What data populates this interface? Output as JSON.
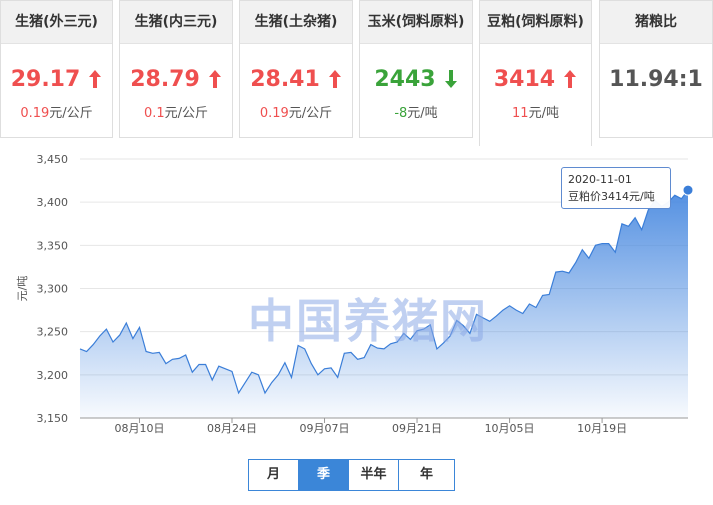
{
  "cards": [
    {
      "title": "生猪(外三元)",
      "price": "29.17",
      "direction": "up",
      "change": "0.19",
      "unit": "元/公斤"
    },
    {
      "title": "生猪(内三元)",
      "price": "28.79",
      "direction": "up",
      "change": "0.1",
      "unit": "元/公斤"
    },
    {
      "title": "生猪(土杂猪)",
      "price": "28.41",
      "direction": "up",
      "change": "0.19",
      "unit": "元/公斤"
    },
    {
      "title": "玉米(饲料原料)",
      "price": "2443",
      "direction": "down",
      "change": "-8",
      "unit": "元/吨"
    },
    {
      "title": "豆粕(饲料原料)",
      "price": "3414",
      "direction": "up",
      "change": "11",
      "unit": "元/吨"
    },
    {
      "title": "猪粮比",
      "price": "11.94:1",
      "direction": "none",
      "change": "",
      "unit": ""
    }
  ],
  "colors": {
    "up": "#ef4f4f",
    "down": "#3aa33a",
    "line": "#3b7ed8",
    "area_top": "#4a8ae0",
    "accent": "#3b86d8"
  },
  "watermark": "中国养猪网",
  "tooltip": {
    "date": "2020-11-01",
    "label": "豆粕价3414元/吨"
  },
  "period_tabs": [
    {
      "label": "月",
      "active": false
    },
    {
      "label": "季",
      "active": true
    },
    {
      "label": "半年",
      "active": false
    },
    {
      "label": "年",
      "active": false
    }
  ],
  "chart_data": {
    "type": "area",
    "title": "",
    "xlabel": "",
    "ylabel": "元/吨",
    "ylim": [
      3150,
      3450
    ],
    "yticks": [
      3150,
      3200,
      3250,
      3300,
      3350,
      3400,
      3450
    ],
    "xticks": [
      "08月10日",
      "08月24日",
      "09月07日",
      "09月21日",
      "10月05日",
      "10月19日"
    ],
    "grid": true,
    "x": [
      "2020-08-01",
      "2020-08-02",
      "2020-08-03",
      "2020-08-04",
      "2020-08-05",
      "2020-08-06",
      "2020-08-07",
      "2020-08-08",
      "2020-08-09",
      "2020-08-10",
      "2020-08-11",
      "2020-08-12",
      "2020-08-13",
      "2020-08-14",
      "2020-08-15",
      "2020-08-16",
      "2020-08-17",
      "2020-08-18",
      "2020-08-19",
      "2020-08-20",
      "2020-08-21",
      "2020-08-22",
      "2020-08-23",
      "2020-08-24",
      "2020-08-25",
      "2020-08-26",
      "2020-08-27",
      "2020-08-28",
      "2020-08-29",
      "2020-08-30",
      "2020-08-31",
      "2020-09-01",
      "2020-09-02",
      "2020-09-03",
      "2020-09-04",
      "2020-09-05",
      "2020-09-06",
      "2020-09-07",
      "2020-09-08",
      "2020-09-09",
      "2020-09-10",
      "2020-09-11",
      "2020-09-12",
      "2020-09-13",
      "2020-09-14",
      "2020-09-15",
      "2020-09-16",
      "2020-09-17",
      "2020-09-18",
      "2020-09-19",
      "2020-09-20",
      "2020-09-21",
      "2020-09-22",
      "2020-09-23",
      "2020-09-24",
      "2020-09-25",
      "2020-09-26",
      "2020-09-27",
      "2020-09-28",
      "2020-09-29",
      "2020-09-30",
      "2020-10-01",
      "2020-10-02",
      "2020-10-03",
      "2020-10-04",
      "2020-10-05",
      "2020-10-06",
      "2020-10-07",
      "2020-10-08",
      "2020-10-09",
      "2020-10-10",
      "2020-10-11",
      "2020-10-12",
      "2020-10-13",
      "2020-10-14",
      "2020-10-15",
      "2020-10-16",
      "2020-10-17",
      "2020-10-18",
      "2020-10-19",
      "2020-10-20",
      "2020-10-21",
      "2020-10-22",
      "2020-10-23",
      "2020-10-24",
      "2020-10-25",
      "2020-10-26",
      "2020-10-27",
      "2020-10-28",
      "2020-10-29",
      "2020-10-30",
      "2020-10-31",
      "2020-11-01"
    ],
    "series": [
      {
        "name": "豆粕价",
        "values": [
          3230,
          3227,
          3235,
          3245,
          3253,
          3238,
          3246,
          3260,
          3242,
          3255,
          3227,
          3225,
          3226,
          3213,
          3218,
          3219,
          3223,
          3203,
          3212,
          3212,
          3194,
          3210,
          3207,
          3204,
          3179,
          3191,
          3203,
          3200,
          3179,
          3191,
          3200,
          3214,
          3197,
          3234,
          3230,
          3213,
          3200,
          3207,
          3208,
          3197,
          3225,
          3226,
          3218,
          3220,
          3235,
          3231,
          3230,
          3236,
          3238,
          3248,
          3241,
          3251,
          3253,
          3258,
          3230,
          3237,
          3245,
          3263,
          3257,
          3248,
          3270,
          3266,
          3262,
          3268,
          3275,
          3280,
          3275,
          3271,
          3282,
          3278,
          3292,
          3293,
          3319,
          3320,
          3318,
          3330,
          3345,
          3335,
          3350,
          3352,
          3352,
          3342,
          3375,
          3372,
          3382,
          3368,
          3391,
          3402,
          3395,
          3400,
          3408,
          3404,
          3414
        ]
      }
    ]
  }
}
